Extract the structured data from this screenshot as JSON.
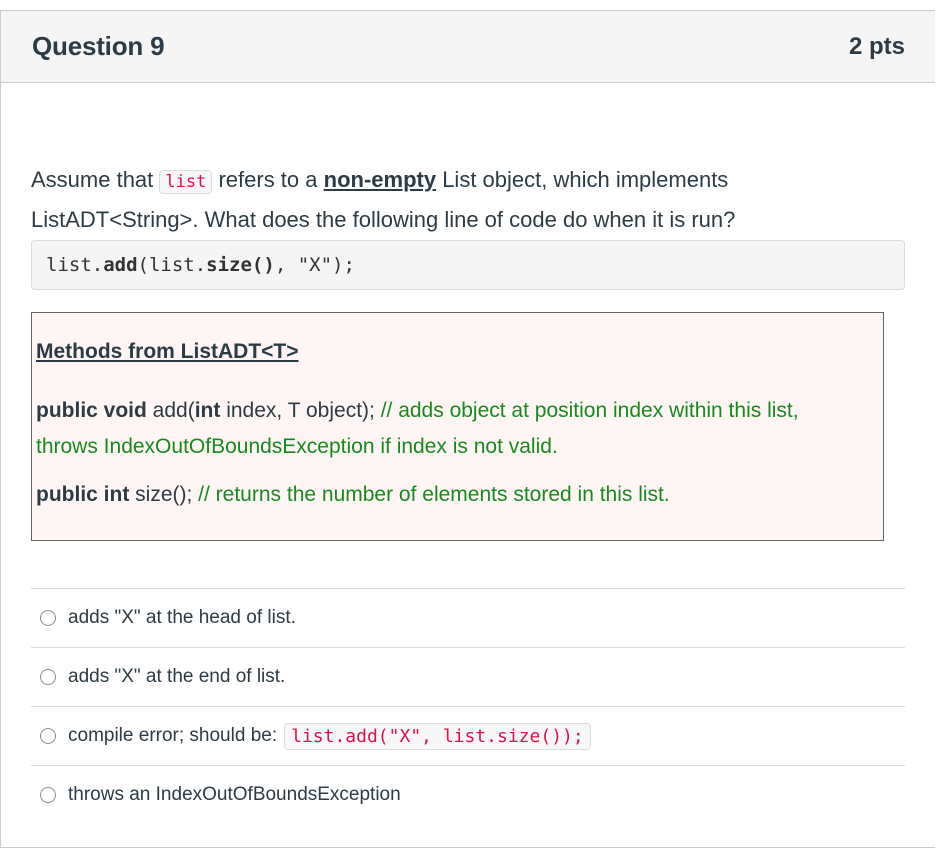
{
  "question": {
    "title": "Question 9",
    "points": "2 pts"
  },
  "prompt": {
    "part1": "Assume that ",
    "code": "list",
    "part2": " refers to a ",
    "emphasis": "non-empty",
    "part3": " List object, which implements ListADT<String>. What does the following line of code do when it is run?"
  },
  "code_line": {
    "seg1": "list.",
    "seg2": "add",
    "seg3": "(list.",
    "seg4": "size()",
    "seg5": ", \"X\");"
  },
  "methods_box": {
    "title": "Methods from ListADT<T>",
    "method1": {
      "kw1": "public void",
      "sig1": " add(",
      "kw2": "int",
      "sig2": " index, T object);  ",
      "comment": "// adds object at position index within this list, throws IndexOutOfBoundsException if index is not valid."
    },
    "method2": {
      "kw": "public int",
      "sig": " size(); ",
      "comment": "// returns the number of elements stored in this list."
    }
  },
  "answers": [
    {
      "text": "adds \"X\" at the head of list."
    },
    {
      "text": "adds \"X\" at the end of list."
    },
    {
      "text": "compile error; should be:",
      "code": "list.add(\"X\", list.size());"
    },
    {
      "text": "throws an IndexOutOfBoundsException"
    }
  ]
}
